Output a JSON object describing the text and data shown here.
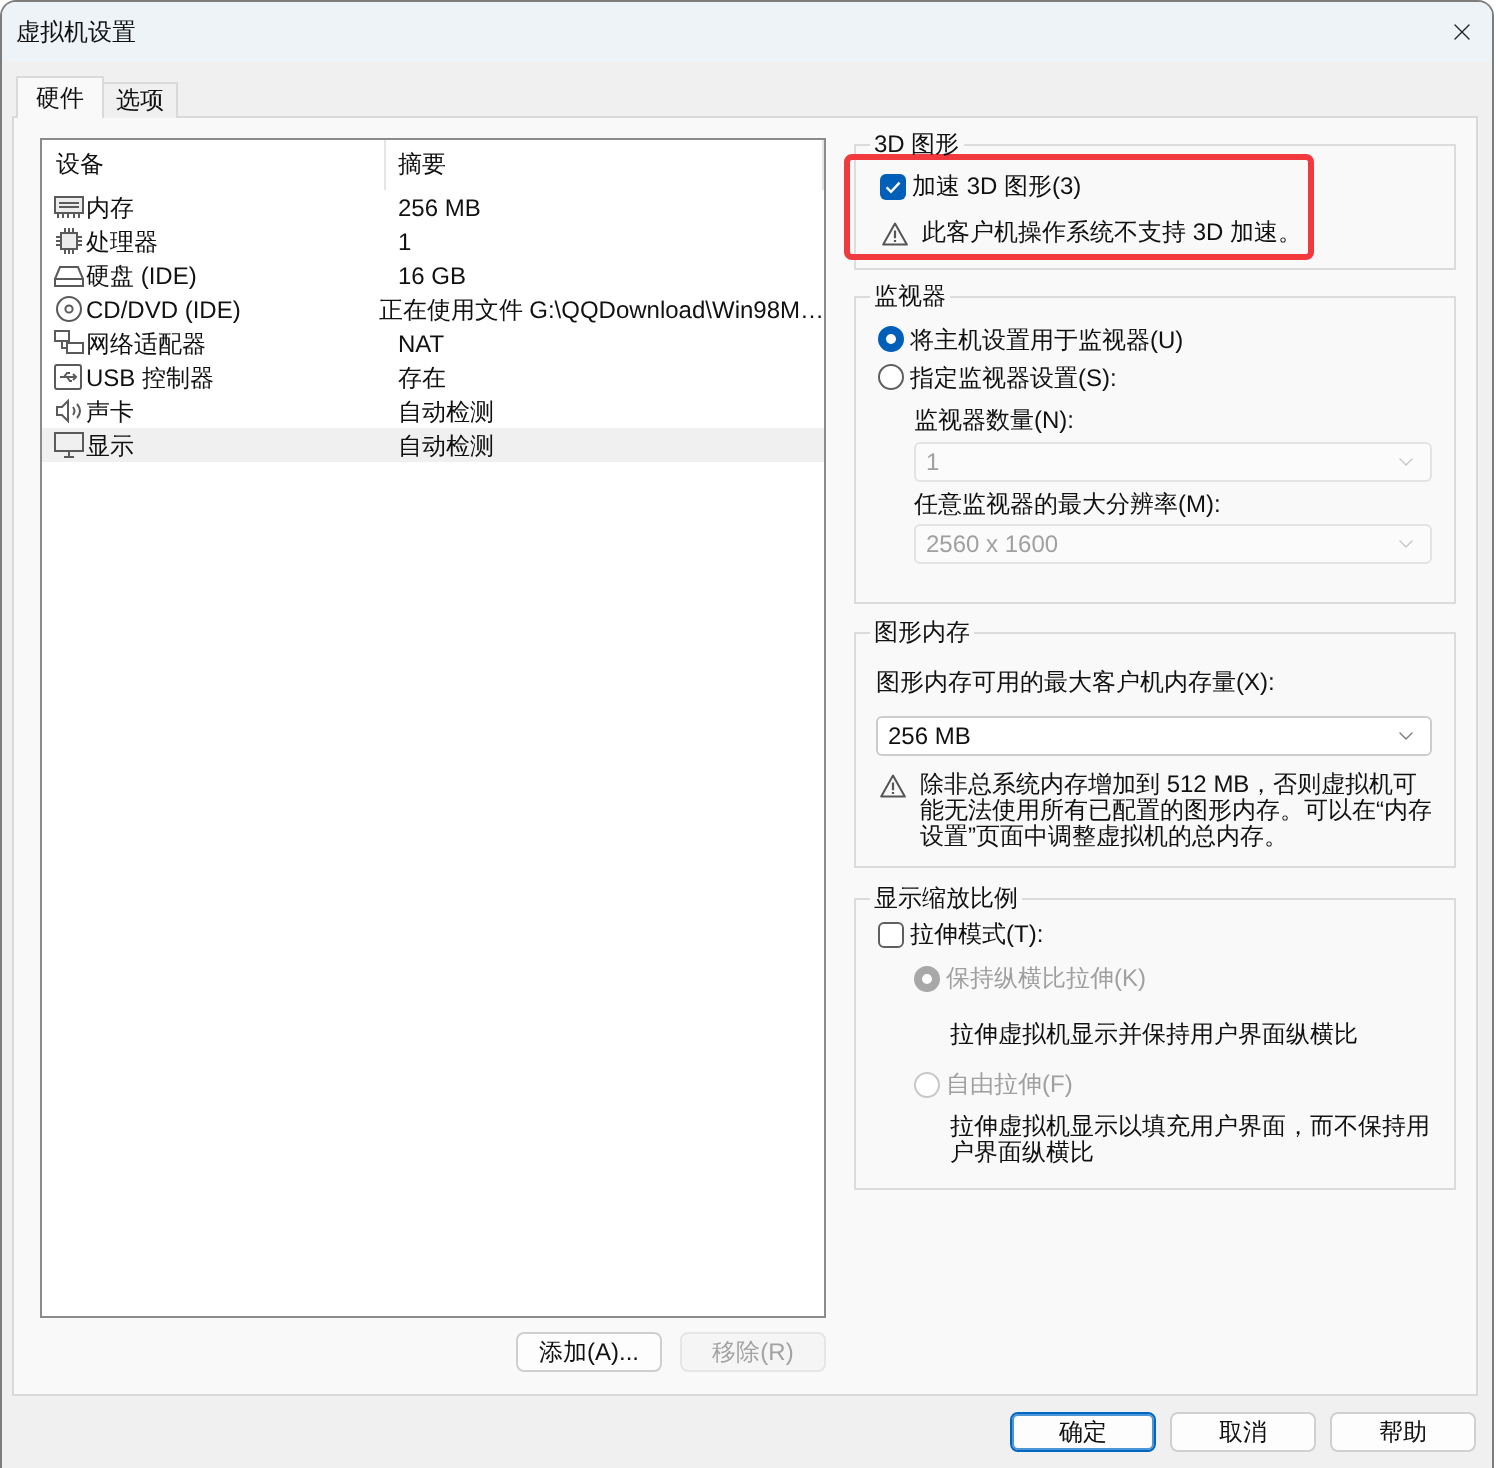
{
  "window": {
    "title": "虚拟机设置"
  },
  "tabs": [
    {
      "label": "硬件",
      "selected": true
    },
    {
      "label": "选项",
      "selected": false
    }
  ],
  "device_table": {
    "columns": [
      "设备",
      "摘要"
    ],
    "rows": [
      {
        "kind": "memory",
        "device": "内存",
        "summary": "256 MB",
        "selected": false
      },
      {
        "kind": "processor",
        "device": "处理器",
        "summary": "1",
        "selected": false
      },
      {
        "kind": "disk",
        "device": "硬盘 (IDE)",
        "summary": "16 GB",
        "selected": false
      },
      {
        "kind": "cdrom",
        "device": "CD/DVD (IDE)",
        "summary": "正在使用文件 G:\\QQDownload\\Win98M…",
        "selected": false
      },
      {
        "kind": "network",
        "device": "网络适配器",
        "summary": "NAT",
        "selected": false
      },
      {
        "kind": "usb",
        "device": "USB 控制器",
        "summary": "存在",
        "selected": false
      },
      {
        "kind": "sound",
        "device": "声卡",
        "summary": "自动检测",
        "selected": false
      },
      {
        "kind": "display",
        "device": "显示",
        "summary": "自动检测",
        "selected": true
      }
    ]
  },
  "device_buttons": [
    {
      "label": "添加(A)...",
      "disabled": false
    },
    {
      "label": "移除(R)",
      "disabled": true
    }
  ],
  "graphics_3d": {
    "title": "3D 图形",
    "highlighted": true,
    "accelerate": {
      "label": "加速 3D 图形(3)",
      "checked": true
    },
    "warning": "此客户机操作系统不支持 3D 加速。"
  },
  "monitors": {
    "title": "监视器",
    "options": [
      {
        "label": "将主机设置用于监视器(U)",
        "selected": true
      },
      {
        "label": "指定监视器设置(S):",
        "selected": false
      }
    ],
    "fields": [
      {
        "label": "监视器数量(N):",
        "value": "1",
        "disabled": true
      },
      {
        "label": "任意监视器的最大分辨率(M):",
        "value": "2560 x 1600",
        "disabled": true
      }
    ]
  },
  "graphics_memory": {
    "title": "图形内存",
    "field": {
      "label": "图形内存可用的最大客户机内存量(X):",
      "value": "256 MB",
      "disabled": false
    },
    "note": "除非总系统内存增加到 512 MB，否则虚拟机可能无法使用所有已配置的图形内存。可以在“内存设置”页面中调整虚拟机的总内存。"
  },
  "display_scaling": {
    "title": "显示缩放比例",
    "stretch": {
      "label": "拉伸模式(T):",
      "checked": false
    },
    "options": [
      {
        "label": "保持纵横比拉伸(K)",
        "selected": true,
        "disabled": true,
        "description": "拉伸虚拟机显示并保持用户界面纵横比"
      },
      {
        "label": "自由拉伸(F)",
        "selected": false,
        "disabled": true,
        "description": "拉伸虚拟机显示以填充用户界面，而不保持用户界面纵横比"
      }
    ]
  },
  "dialog_buttons": [
    {
      "label": "确定",
      "default": true
    },
    {
      "label": "取消",
      "default": false
    },
    {
      "label": "帮助",
      "default": false
    }
  ]
}
